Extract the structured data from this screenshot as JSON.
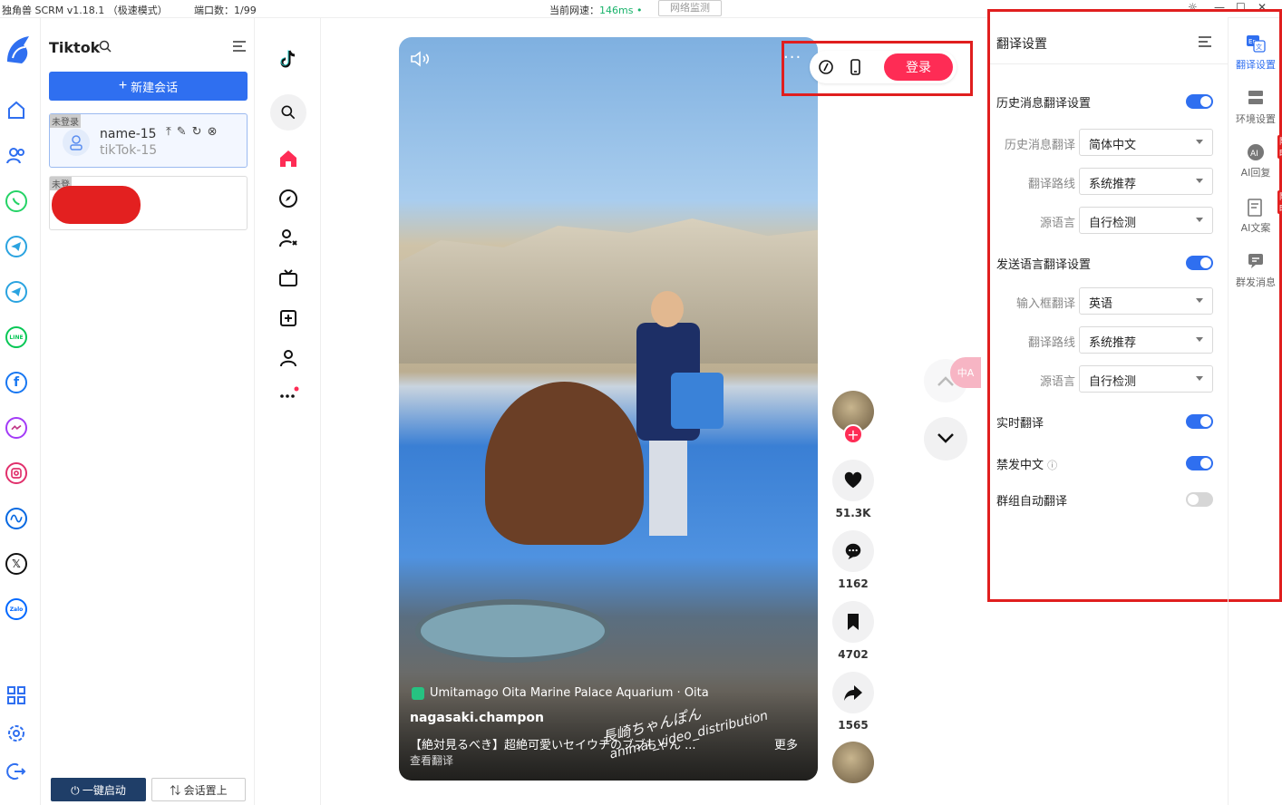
{
  "titlebar": {
    "app_title": "独角兽 SCRM v1.18.1 （极速模式）",
    "ports": "端口数：1/99",
    "speed_label": "当前网速：",
    "speed_value": "146ms",
    "monitor": "网络监测"
  },
  "rail": {
    "icons": [
      "unicorn-logo",
      "home-icon",
      "contacts-icon",
      "whatsapp-icon",
      "telegram-icon",
      "telegram-alt-icon",
      "line-icon",
      "facebook-icon",
      "messenger-icon",
      "instagram-icon",
      "meta-icon",
      "x-icon",
      "zalo-icon",
      "apps-grid-icon",
      "settings-icon",
      "logout-icon"
    ]
  },
  "sessions": {
    "title": "Tiktok",
    "new_session": "新建会话",
    "items": [
      {
        "tag": "未登录",
        "name": "name-15",
        "sub": "tikTok-15"
      },
      {
        "tag": "未登"
      }
    ],
    "one_click_start": "一键启动",
    "pin_session": "会话置上"
  },
  "video": {
    "location": "Umitamago Oita Marine Palace Aquarium · Oita",
    "author": "nagasaki.champon",
    "description": "【絶対見るべき】超絶可愛いセイウチのブブちゃん ...",
    "more": "更多",
    "translate": "查看翻译",
    "watermark_1": "長崎ちゃんぽん",
    "watermark_2": "animal_video_distribution",
    "login": "登录"
  },
  "actions": {
    "likes": "51.3K",
    "comments": "1162",
    "saves": "4702",
    "shares": "1565"
  },
  "settings": {
    "title": "翻译设置",
    "history_section": "历史消息翻译设置",
    "history_translate_label": "历史消息翻译",
    "history_translate_value": "简体中文",
    "history_route_label": "翻译路线",
    "history_route_value": "系统推荐",
    "history_source_label": "源语言",
    "history_source_value": "自行检测",
    "send_section": "发送语言翻译设置",
    "input_translate_label": "输入框翻译",
    "input_translate_value": "英语",
    "send_route_label": "翻译路线",
    "send_route_value": "系统推荐",
    "send_source_label": "源语言",
    "send_source_value": "自行检测",
    "realtime": "实时翻译",
    "ban_chinese": "禁发中文",
    "group_auto": "群组自动翻译"
  },
  "tools": {
    "translate_settings": "翻译设置",
    "env_settings": "环境设置",
    "ai_reply": "AI回复",
    "ai_copy": "AI文案",
    "broadcast": "群发消息",
    "limited": "限时",
    "ai_badge": "AI"
  },
  "colors": {
    "primary": "#2f6ff0",
    "tiktok_red": "#fe2c55",
    "highlight_red": "#e01e1e",
    "speed_green": "#19b36b"
  }
}
